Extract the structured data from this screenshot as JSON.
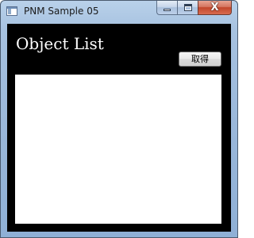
{
  "window": {
    "title": "PNM Sample 05",
    "close_glyph": "X"
  },
  "main": {
    "heading": "Object List",
    "get_button_label": "取得",
    "list_items": []
  }
}
